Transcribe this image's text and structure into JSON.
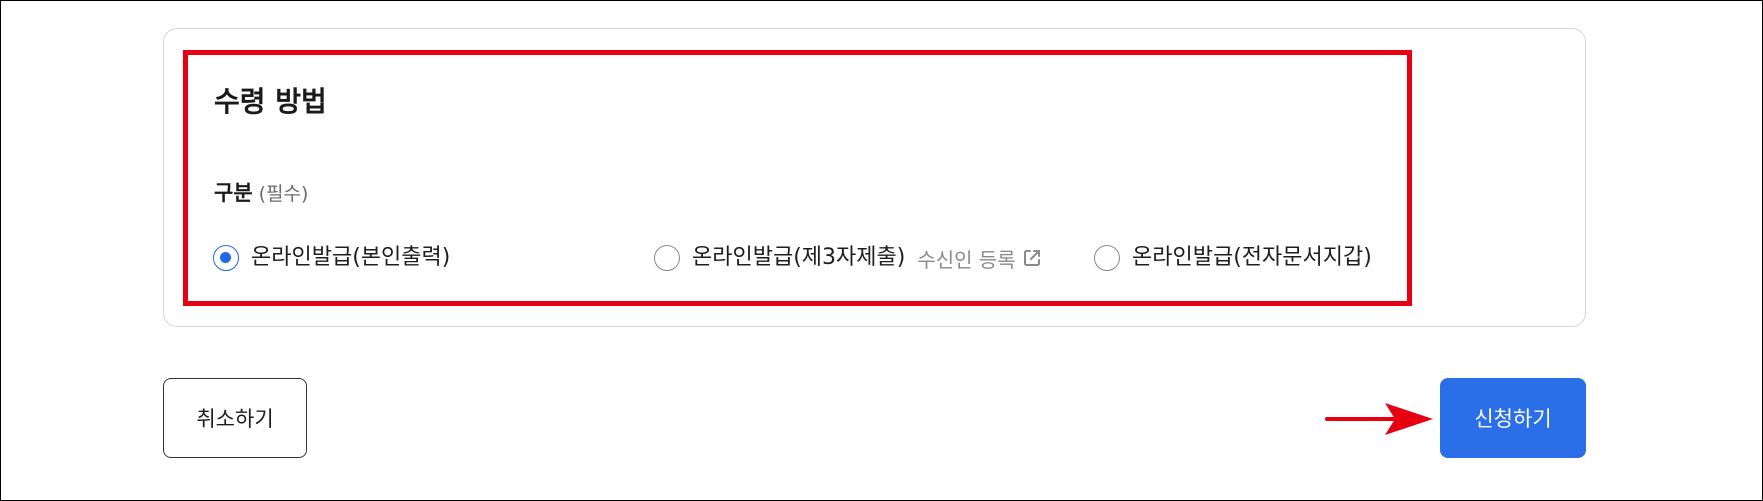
{
  "section": {
    "title": "수령 방법",
    "field_label": "구분",
    "required_label": "(필수)"
  },
  "options": [
    {
      "label": "온라인발급(본인출력)",
      "checked": true
    },
    {
      "label": "온라인발급(제3자제출)",
      "checked": false,
      "link_label": "수신인 등록"
    },
    {
      "label": "온라인발급(전자문서지갑)",
      "checked": false
    }
  ],
  "buttons": {
    "cancel": "취소하기",
    "submit": "신청하기"
  },
  "colors": {
    "accent": "#2a6fe8",
    "highlight": "#e60012",
    "annotation_arrow": "#e60012"
  }
}
